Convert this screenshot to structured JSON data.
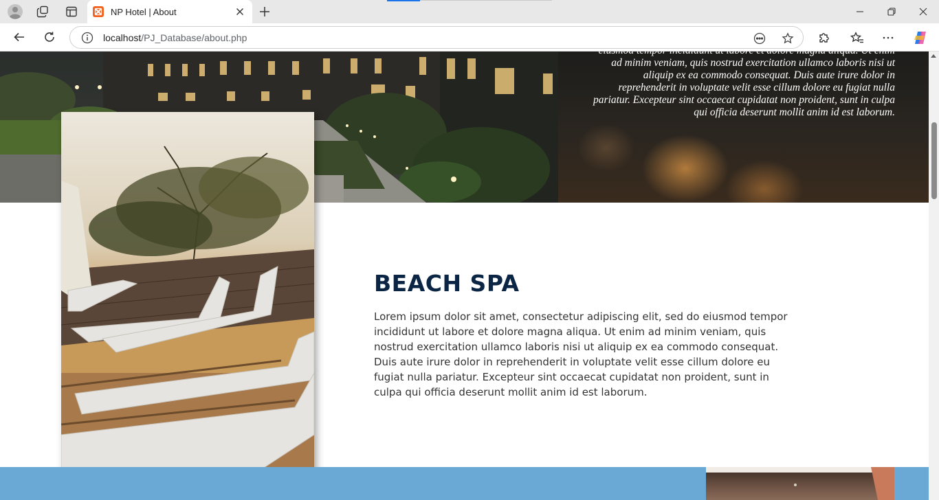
{
  "browser": {
    "tab_title": "NP Hotel | About",
    "url_host": "localhost",
    "url_path": "/PJ_Database/about.php"
  },
  "icons": {
    "profile": "profile-avatar-icon",
    "workspaces": "workspaces-icon",
    "tab_actions": "vertical-tabs-icon",
    "tab_favicon": "xampp-favicon-icon",
    "tab_close": "close-icon",
    "new_tab": "plus-icon",
    "minimize": "minimize-icon",
    "restore": "restore-icon",
    "close_window": "close-window-icon",
    "back": "back-arrow-icon",
    "refresh": "refresh-icon",
    "site_info": "info-icon",
    "read_aloud": "read-aloud-icon",
    "favorite": "star-icon",
    "extensions": "puzzle-icon",
    "favorites": "favorites-icon",
    "more": "more-icon",
    "copilot": "copilot-icon"
  },
  "hero": {
    "text": "eiusmod tempor incididunt ut labore et dolore magna aliqua. Ut enim ad minim veniam, quis nostrud exercitation ullamco laboris nisi ut aliquip ex ea commodo consequat. Duis aute irure dolor in reprehenderit in voluptate velit esse cillum dolore eu fugiat nulla pariatur. Excepteur sint occaecat cupidatat non proident, sunt in culpa qui officia deserunt mollit anim id est laborum."
  },
  "spa": {
    "heading": "BEACH SPA",
    "body": "Lorem ipsum dolor sit amet, consectetur adipiscing elit, sed do eiusmod tempor incididunt ut labore et dolore magna aliqua. Ut enim ad minim veniam, quis nostrud exercitation ullamco laboris nisi ut aliquip ex ea commodo consequat. Duis aute irure dolor in reprehenderit in voluptate velit esse cillum dolore eu fugiat nulla pariatur. Excepteur sint occaecat cupidatat non proident, sunt in culpa qui officia deserunt mollit anim id est laborum."
  },
  "colors": {
    "heading": "#0b2545",
    "band": "#6aa9d6"
  }
}
